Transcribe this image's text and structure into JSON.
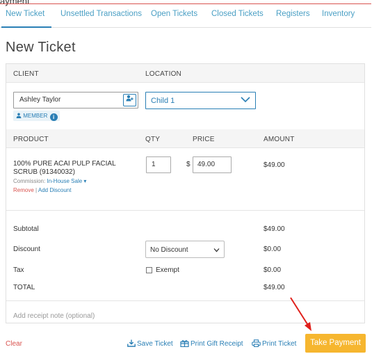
{
  "top_cut_text": "ayment",
  "tabs": [
    {
      "label": "New Ticket"
    },
    {
      "label": "Unsettled Transactions"
    },
    {
      "label": "Open Tickets"
    },
    {
      "label": "Closed Tickets"
    },
    {
      "label": "Registers"
    },
    {
      "label": "Inventory"
    }
  ],
  "page_title": "New Ticket",
  "headers": {
    "client": "CLIENT",
    "location": "LOCATION",
    "product": "PRODUCT",
    "qty": "QTY",
    "price": "PRICE",
    "amount": "AMOUNT"
  },
  "client": {
    "name": "Ashley Taylor",
    "badge": "MEMBER"
  },
  "location": {
    "selected": "Child 1"
  },
  "line_item": {
    "name": "100% PURE ACAI PULP FACIAL SCRUB (91340032)",
    "commission_label": "Commission:",
    "commission_value": "In-House Sale",
    "remove": "Remove",
    "separator": "|",
    "add_discount": "Add Discount",
    "qty": "1",
    "currency": "$",
    "price": "49.00",
    "amount": "$49.00"
  },
  "summary": {
    "subtotal_label": "Subtotal",
    "subtotal": "$49.00",
    "discount_label": "Discount",
    "discount_selected": "No Discount",
    "discount": "$0.00",
    "tax_label": "Tax",
    "exempt_label": "Exempt",
    "tax": "$0.00",
    "total_label": "TOTAL",
    "total": "$49.00"
  },
  "receipt_note_placeholder": "Add receipt note (optional)",
  "footer": {
    "clear": "Clear",
    "save_ticket": "Save Ticket",
    "print_gift_receipt": "Print Gift Receipt",
    "print_ticket": "Print Ticket",
    "take_payment": "Take Payment"
  },
  "colors": {
    "accent": "#2a7fb5",
    "danger": "#d9534f",
    "payment": "#f6b62f"
  }
}
